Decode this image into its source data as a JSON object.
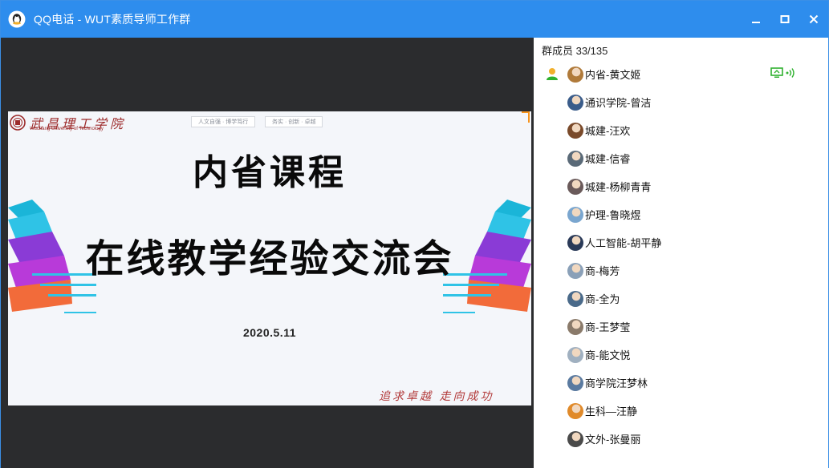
{
  "window": {
    "title": "QQ电话 - WUT素质导师工作群",
    "controls": [
      "minimize-icon",
      "maximize-icon",
      "close-icon"
    ]
  },
  "slide": {
    "school_name_cn": "武昌理工学院",
    "school_name_en": "Wuchang University of Technology",
    "header_box_1": "人文自强 · 博学笃行",
    "header_box_2": "务实 · 创新 · 卓越",
    "title": "内省课程",
    "subtitle": "在线教学经验交流会",
    "date": "2020.5.11",
    "motto": "追求卓越  走向成功"
  },
  "members": {
    "count_label": "群成员 33/135",
    "list": [
      {
        "name": "内省-黄文姬",
        "avatar_color": "#b07a3a",
        "speaking": true
      },
      {
        "name": "通识学院-曾洁",
        "avatar_color": "#3a5c8a"
      },
      {
        "name": "城建-汪欢",
        "avatar_color": "#7a4a2a"
      },
      {
        "name": "城建-信睿",
        "avatar_color": "#5a6a78"
      },
      {
        "name": "城建-杨柳青青",
        "avatar_color": "#6a5a5a"
      },
      {
        "name": "护理-鲁晓煜",
        "avatar_color": "#7aa6cf"
      },
      {
        "name": "人工智能-胡平静",
        "avatar_color": "#2a3a58"
      },
      {
        "name": "商-梅芳",
        "avatar_color": "#8aa0b8"
      },
      {
        "name": "商-全为",
        "avatar_color": "#4a6a8a"
      },
      {
        "name": "商-王梦莹",
        "avatar_color": "#8a7a6a"
      },
      {
        "name": "商-能文悦",
        "avatar_color": "#a0b0c0"
      },
      {
        "name": "商学院汪梦林",
        "avatar_color": "#5a7aa0"
      },
      {
        "name": "生科—汪静",
        "avatar_color": "#e08a2a"
      },
      {
        "name": "文外-张曼丽",
        "avatar_color": "#4a4a4a"
      }
    ]
  },
  "colors": {
    "titlebar": "#2e8ded",
    "video_bg": "#2b2c2e",
    "speaking": "#2fb12f"
  }
}
